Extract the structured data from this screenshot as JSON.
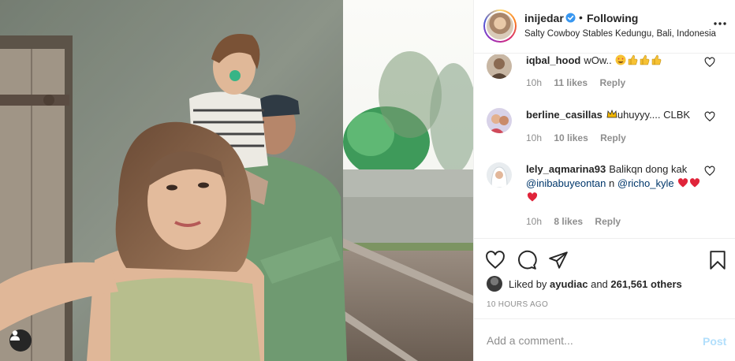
{
  "post": {
    "username": "inijedar",
    "follow_label": "Following",
    "location": "Salty Cowboy Stables Kedungu, Bali, Indonesia"
  },
  "comments": [
    {
      "username": "iqbal_hood",
      "text": "wOw..",
      "emoji": [
        "heart-eyes",
        "thumbs-up",
        "thumbs-up",
        "thumbs-up"
      ],
      "time": "10h",
      "likes": "11 likes",
      "reply": "Reply"
    },
    {
      "username": "berline_casillas",
      "text": "uhuyyy.... CLBK",
      "emoji_before": [
        "crown"
      ],
      "time": "10h",
      "likes": "10 likes",
      "reply": "Reply"
    },
    {
      "username": "lely_aqmarina93",
      "text": "Balikqn dong kak",
      "mention1": "@inibabuyeontan",
      "text_mid": "n",
      "mention2": "@richo_kyle",
      "emoji": [
        "heart",
        "heart",
        "heart"
      ],
      "time": "10h",
      "likes": "8 likes",
      "reply": "Reply"
    }
  ],
  "likes": {
    "prefix": "Liked by",
    "user": "ayudiac",
    "conj": "and",
    "count": "261,561 others"
  },
  "timestamp": "10 HOURS AGO",
  "composer": {
    "placeholder": "Add a comment...",
    "post_label": "Post"
  },
  "colors": {
    "accent": "#0095f6",
    "post_disabled": "#b2dffc",
    "secondary_text": "#8e8e8e",
    "mention": "#00376b",
    "heart": "#ed4956"
  }
}
